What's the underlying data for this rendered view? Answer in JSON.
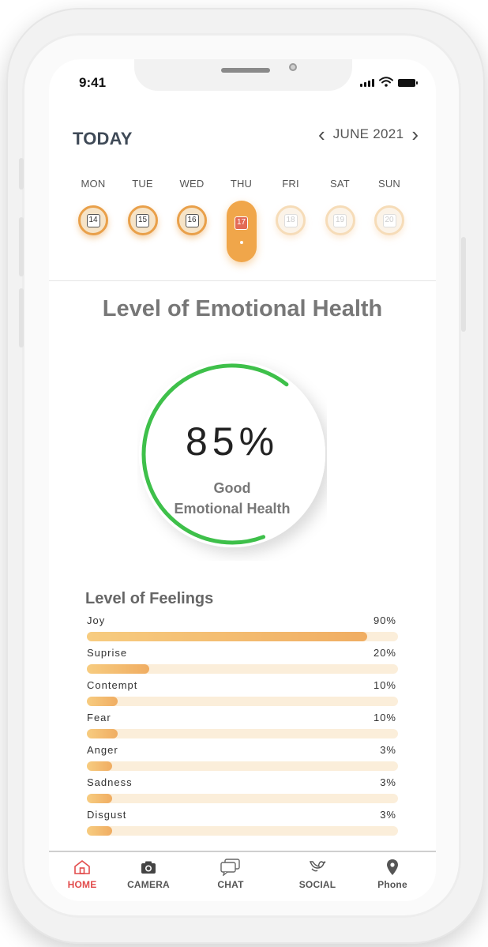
{
  "status_bar": {
    "time": "9:41"
  },
  "header": {
    "title": "TODAY",
    "month": "JUNE 2021"
  },
  "week": [
    {
      "day": "MON",
      "date": "14",
      "state": "past"
    },
    {
      "day": "TUE",
      "date": "15",
      "state": "past"
    },
    {
      "day": "WED",
      "date": "16",
      "state": "past"
    },
    {
      "day": "THU",
      "date": "17",
      "state": "active"
    },
    {
      "day": "FRI",
      "date": "18",
      "state": "future"
    },
    {
      "day": "SAT",
      "date": "19",
      "state": "future"
    },
    {
      "day": "SUN",
      "date": "20",
      "state": "future"
    }
  ],
  "emotional_health": {
    "title": "Level of Emotional Health",
    "percent_label": "85%",
    "percent": 85,
    "status_line1": "Good",
    "status_line2": "Emotional Health",
    "ring_color": "#3ec04a"
  },
  "feelings": {
    "title": "Level of Feelings",
    "items": [
      {
        "name": "Joy",
        "label": "90%",
        "value": 90
      },
      {
        "name": "Suprise",
        "label": "20%",
        "value": 20
      },
      {
        "name": "Contempt",
        "label": "10%",
        "value": 10
      },
      {
        "name": "Fear",
        "label": "10%",
        "value": 10
      },
      {
        "name": "Anger",
        "label": "3%",
        "value": 3
      },
      {
        "name": "Sadness",
        "label": "3%",
        "value": 3
      },
      {
        "name": "Disgust",
        "label": "3%",
        "value": 3
      }
    ]
  },
  "tabs": [
    {
      "id": "home",
      "label": "HOME",
      "icon": "home-icon",
      "active": true
    },
    {
      "id": "camera",
      "label": "CAMERA",
      "icon": "camera-icon",
      "active": false
    },
    {
      "id": "chat",
      "label": "CHAT",
      "icon": "chat-icon",
      "active": false
    },
    {
      "id": "social",
      "label": "SOCIAL",
      "icon": "bird-icon",
      "active": false
    },
    {
      "id": "phone",
      "label": "Phone",
      "icon": "location-pin-icon",
      "active": false
    }
  ],
  "colors": {
    "accent": "#f0a64a",
    "active_tab": "#e24b4b",
    "bar_track": "#fbeeda"
  }
}
